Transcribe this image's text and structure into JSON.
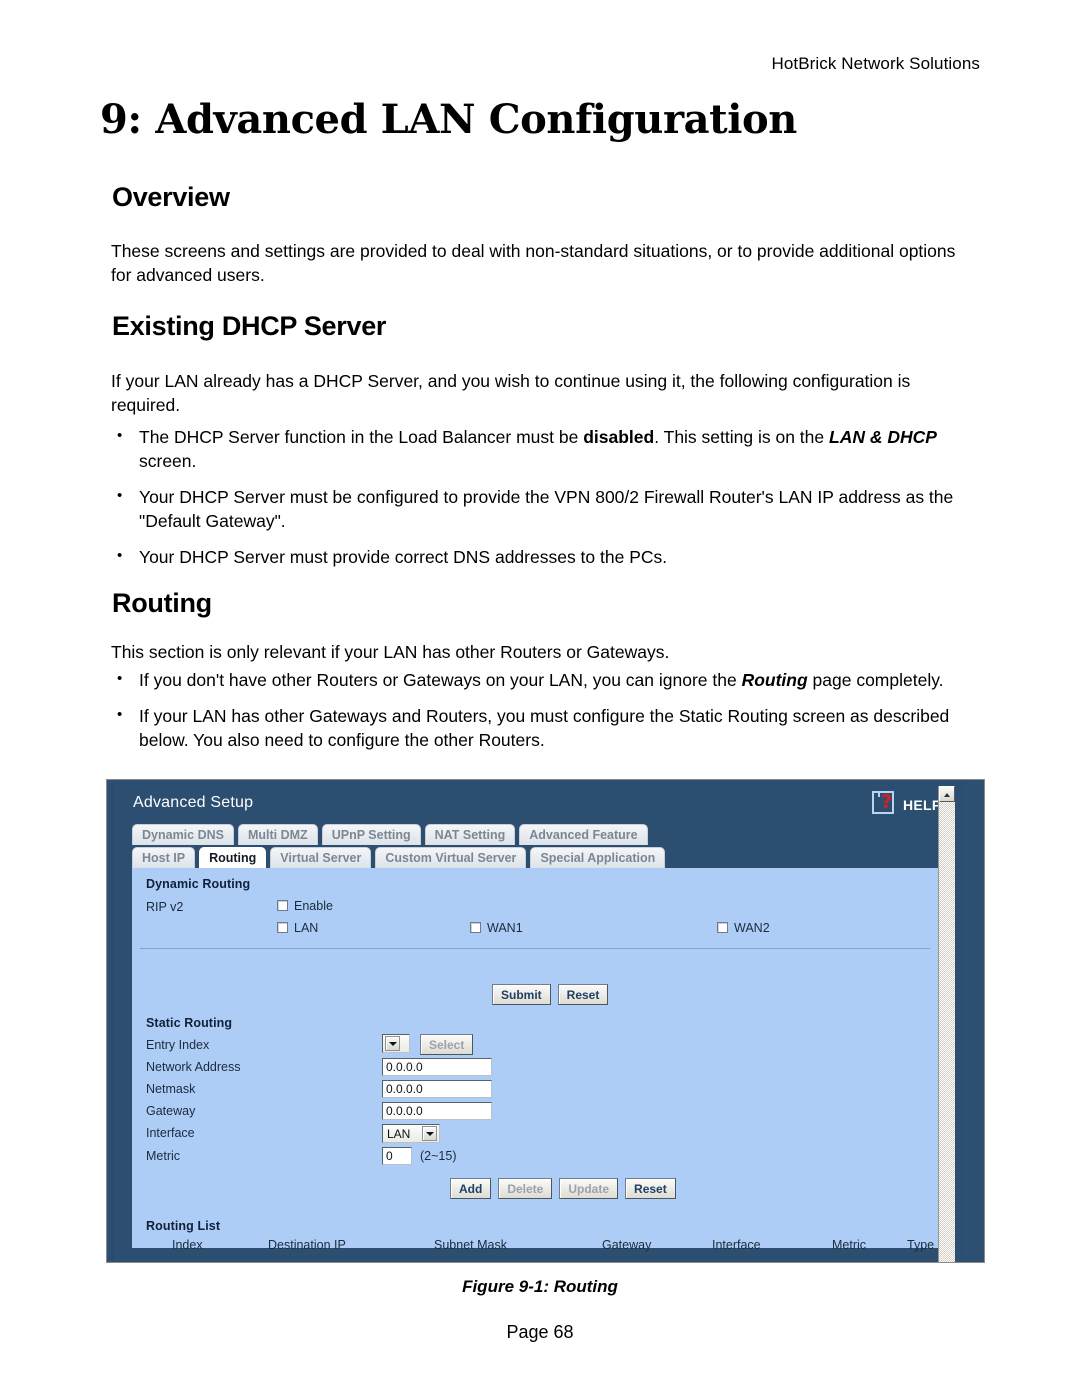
{
  "document": {
    "running_head": "HotBrick Network Solutions",
    "chapter_title": "9: Advanced LAN Configuration",
    "page_footer": "Page 68",
    "figure_caption": "Figure 9-1:  Routing",
    "sections": {
      "overview": {
        "heading": "Overview",
        "paragraph": "These screens and settings are provided to deal with non-standard situations, or to provide additional options for advanced users."
      },
      "existing_dhcp": {
        "heading": "Existing DHCP Server",
        "paragraph": "If your LAN already has a DHCP Server, and you wish to continue using it, the following configuration is required.",
        "bullets": [
          {
            "pre": "The DHCP Server function in the Load Balancer must be ",
            "bold": "disabled",
            "mid": ". This setting is on the ",
            "bold_italic": "LAN & DHCP",
            "post": " screen."
          },
          {
            "pre": "Your DHCP Server must be configured to provide the VPN 800/2 Firewall Router's LAN IP address as the \"Default Gateway\".",
            "bold": "",
            "mid": "",
            "bold_italic": "",
            "post": ""
          },
          {
            "pre": "Your DHCP Server must provide correct DNS addresses to the PCs.",
            "bold": "",
            "mid": "",
            "bold_italic": "",
            "post": ""
          }
        ]
      },
      "routing": {
        "heading": "Routing",
        "paragraph": "This section is only relevant if your LAN has other Routers or Gateways.",
        "bullets": [
          {
            "pre": "If you don't have other Routers or Gateways on your LAN, you can ignore the ",
            "bold": "",
            "mid": "",
            "bold_italic": "Routing",
            "post": " page completely."
          },
          {
            "pre": "If your LAN has other Gateways and Routers, you must configure the Static Routing screen as described below. You also need to configure the other Routers.",
            "bold": "",
            "mid": "",
            "bold_italic": "",
            "post": ""
          }
        ]
      }
    }
  },
  "router_ui": {
    "app_title": "Advanced Setup",
    "help_label": "HELP",
    "tabs_row1": [
      {
        "label": "Dynamic DNS",
        "active": false
      },
      {
        "label": "Multi DMZ",
        "active": false
      },
      {
        "label": "UPnP Setting",
        "active": false
      },
      {
        "label": "NAT Setting",
        "active": false
      },
      {
        "label": "Advanced Feature",
        "active": false
      }
    ],
    "tabs_row2": [
      {
        "label": "Host IP",
        "active": false
      },
      {
        "label": "Routing",
        "active": true
      },
      {
        "label": "Virtual Server",
        "active": false
      },
      {
        "label": "Custom Virtual Server",
        "active": false
      },
      {
        "label": "Special Application",
        "active": false
      }
    ],
    "dynamic_routing": {
      "group_label": "Dynamic Routing",
      "rip_label": "RIP v2",
      "checkboxes": [
        {
          "label": "Enable",
          "checked": false
        },
        {
          "label": "LAN",
          "checked": false
        },
        {
          "label": "WAN1",
          "checked": false
        },
        {
          "label": "WAN2",
          "checked": false
        }
      ],
      "submit_label": "Submit",
      "reset_label": "Reset"
    },
    "static_routing": {
      "group_label": "Static Routing",
      "entry_index_label": "Entry Index",
      "entry_index_value": "",
      "select_button": "Select",
      "network_address_label": "Network Address",
      "network_address_value": "0.0.0.0",
      "netmask_label": "Netmask",
      "netmask_value": "0.0.0.0",
      "gateway_label": "Gateway",
      "gateway_value": "0.0.0.0",
      "interface_label": "Interface",
      "interface_value": "LAN",
      "metric_label": "Metric",
      "metric_value": "0",
      "metric_hint": "(2~15)",
      "add_label": "Add",
      "delete_label": "Delete",
      "update_label": "Update",
      "reset_label": "Reset"
    },
    "routing_list": {
      "group_label": "Routing List",
      "columns": [
        "Index",
        "Destination IP",
        "Subnet Mask",
        "Gateway",
        "Interface",
        "Metric",
        "Type"
      ],
      "rows": []
    },
    "colors": {
      "header_blue": "#2b4e71",
      "panel_blue": "#aecdf6",
      "active_tab": "#ffffff",
      "help_red": "#d81f26"
    }
  }
}
